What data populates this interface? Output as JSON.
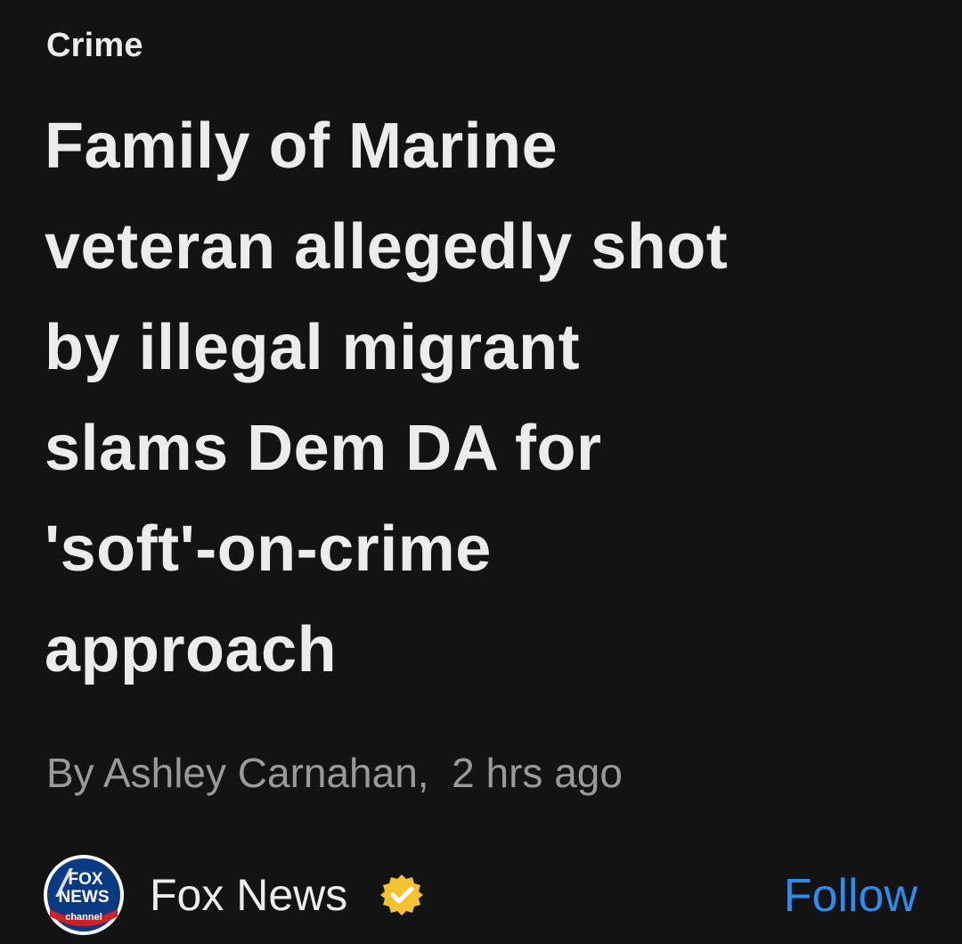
{
  "article": {
    "category": "Crime",
    "headline_lines": [
      "Family of Marine",
      "veteran allegedly shot",
      "by illegal migrant",
      "slams Dem DA for",
      "'soft'-on-crime",
      "approach"
    ],
    "byline": "By Ashley Carnahan,  2 hrs ago"
  },
  "source": {
    "name": "Fox News",
    "logo_text_top": "FOX",
    "logo_text_middle": "NEWS",
    "logo_text_bottom": "channel",
    "logo_icon": "fox-news-logo",
    "verified_icon": "verified-badge-icon",
    "follow_label": "Follow"
  },
  "colors": {
    "background": "#131313",
    "text": "#ececec",
    "byline": "#9a9a9a",
    "follow": "#2d8cf0",
    "verified_badge": "#f2c230"
  }
}
